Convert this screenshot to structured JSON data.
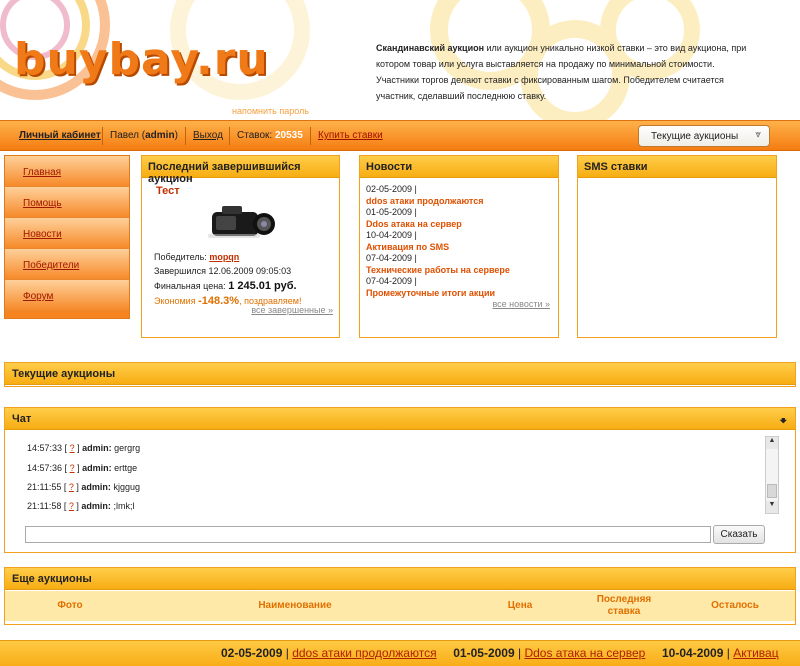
{
  "header": {
    "logo_text": "buybay.ru",
    "remind_password": "напомнить пароль",
    "desc_bold": "Скандинавский аукцион",
    "desc_rest": " или аукцион уникально низкой ставки – это вид аукциона, при котором товар или услуга выставляется на продажу по минимальной стоимости. Участники торгов делают ставки с фиксированным шагом. Победителем считается участник, сделавший последнюю ставку."
  },
  "topbar": {
    "cabinet": "Личный кабинет",
    "user_name": "Павел",
    "user_login": "admin",
    "logout": "Выход",
    "bids_label": "Ставок:",
    "bids_count": "20535",
    "buy_bids": "Купить ставки",
    "select_value": "Текущие аукционы"
  },
  "menu": {
    "items": [
      "Главная",
      "Помощь",
      "Новости",
      "Победители",
      "Форум"
    ]
  },
  "last_auction": {
    "header": "Последний завершившийся аукцион",
    "title": "Тест",
    "winner_label": "Победитель:",
    "winner": "mopqn",
    "finished_label": "Завершился 12.06.2009 09:05:03",
    "final_price_label": "Финальная цена:",
    "final_price": "1 245.01 руб.",
    "economy_label": "Экономия",
    "economy_value": "-148.3%",
    "economy_suffix": ", поздравляем!",
    "all_finished": "все завершенные »"
  },
  "news": {
    "header": "Новости",
    "items": [
      {
        "date": "02-05-2009 |",
        "title": "ddos атаки продолжаются"
      },
      {
        "date": "01-05-2009 |",
        "title": "Ddos атака на сервер"
      },
      {
        "date": "10-04-2009 |",
        "title": "Активация по SMS"
      },
      {
        "date": "07-04-2009 |",
        "title": "Технические работы на сервере"
      },
      {
        "date": "07-04-2009 |",
        "title": "Промежуточные итоги акции"
      }
    ],
    "all_news": "все новости »"
  },
  "sms": {
    "header": "SMS ставки"
  },
  "current_auctions": {
    "header": "Текущие аукционы"
  },
  "chat": {
    "header": "Чат",
    "messages": [
      {
        "time": "14:57:33",
        "q": "?",
        "user": "admin:",
        "text": "gergrg"
      },
      {
        "time": "14:57:36",
        "q": "?",
        "user": "admin:",
        "text": "erttge"
      },
      {
        "time": "21:11:55",
        "q": "?",
        "user": "admin:",
        "text": "kjggug"
      },
      {
        "time": "21:11:58",
        "q": "?",
        "user": "admin:",
        "text": ";lmk;l"
      }
    ],
    "input_value": "",
    "send_label": "Сказать"
  },
  "more_auctions": {
    "header": "Еще аукционы",
    "columns": [
      "Фото",
      "Наименование",
      "Цена",
      "Последняя ставка",
      "Осталось"
    ]
  },
  "ticker": {
    "items": [
      {
        "date": "02-05-2009",
        "title": "ddos атаки продолжаются"
      },
      {
        "date": "01-05-2009",
        "title": "Ddos атака на сервер"
      },
      {
        "date": "10-04-2009",
        "title": "Активац"
      }
    ]
  },
  "colors": {
    "accent_orange": "#f47c12",
    "panel_yellow": "#f7ad12",
    "link_red": "#c03000"
  }
}
